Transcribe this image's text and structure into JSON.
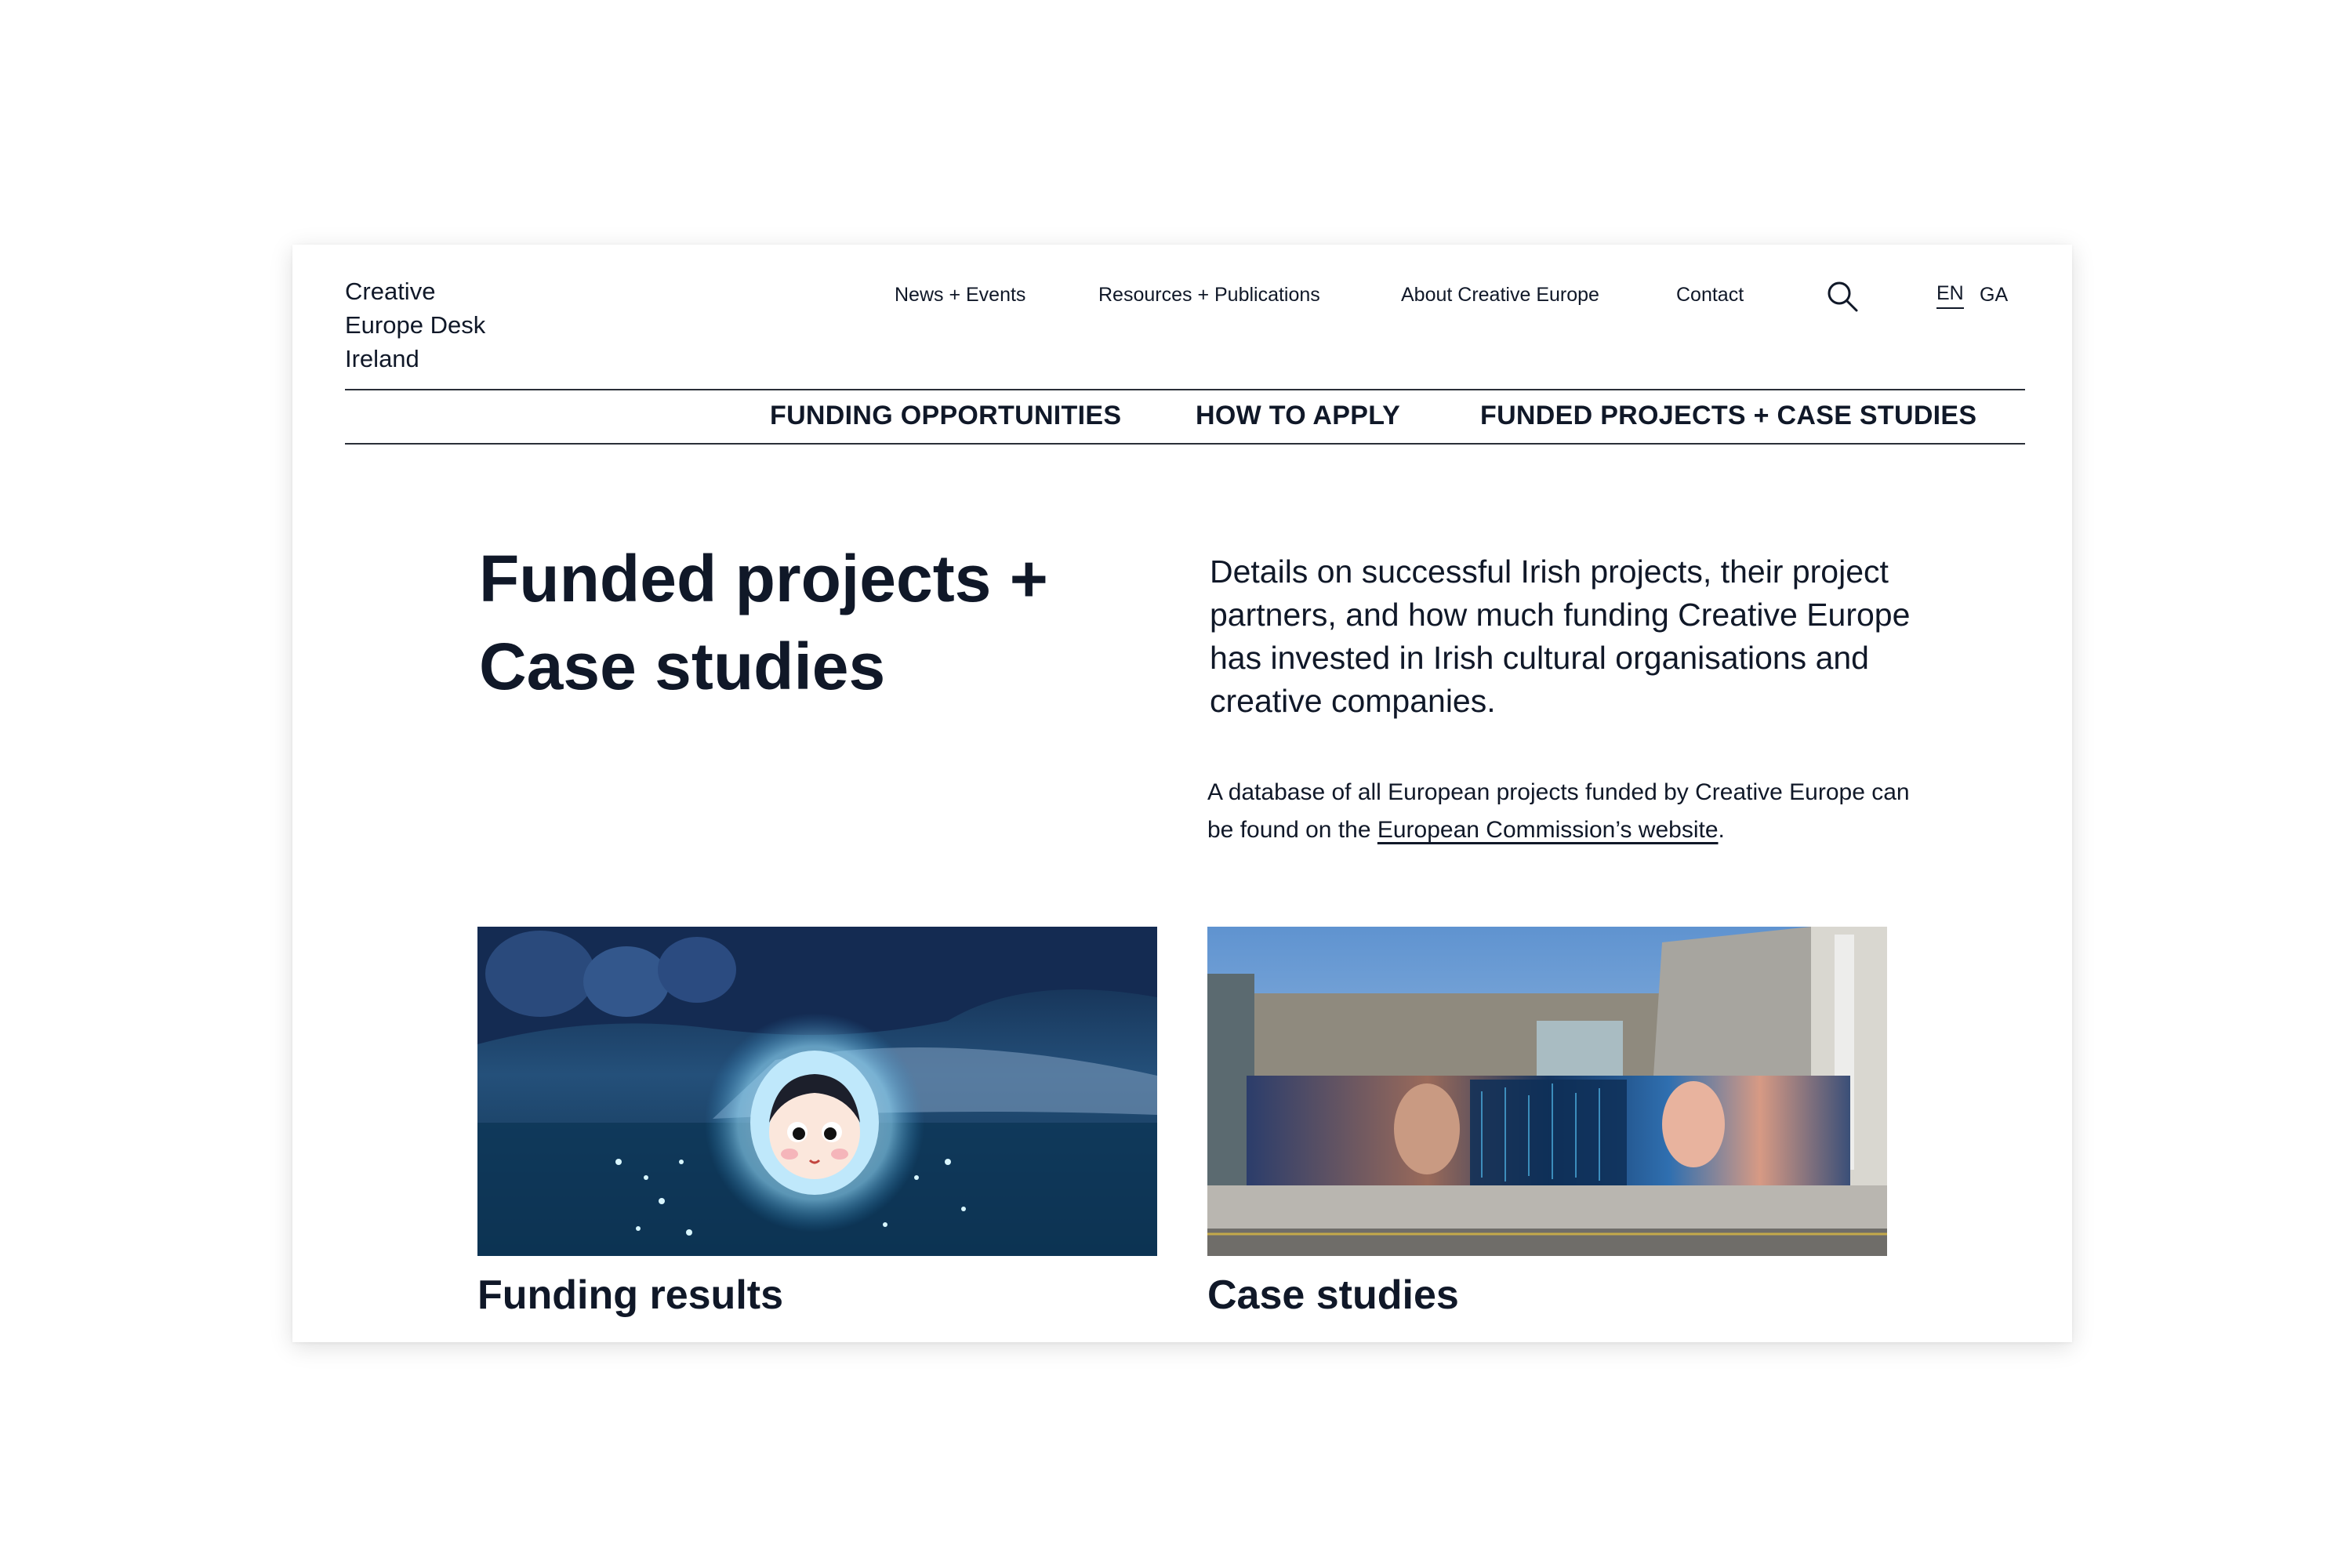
{
  "logo": {
    "text": "Creative\nEurope Desk\nIreland"
  },
  "top_nav": {
    "items": [
      "News + Events",
      "Resources + Publications",
      "About Creative Europe",
      "Contact"
    ],
    "search_icon": "search-icon",
    "languages": {
      "active": "EN",
      "other": "GA"
    }
  },
  "sub_nav": {
    "items": [
      "FUNDING OPPORTUNITIES",
      "HOW TO APPLY",
      "FUNDED PROJECTS + CASE STUDIES"
    ]
  },
  "main": {
    "title": "Funded projects + Case studies",
    "intro": "Details on successful Irish projects, their project partners, and how much funding Creative Europe has invested in Irish cultural organisations and creative companies.",
    "note_prefix": "A database of all European projects funded by Creative Europe can be found on the ",
    "note_link": "European Commission’s website",
    "note_suffix": "."
  },
  "cards": [
    {
      "title": "Funding results",
      "image": "animated-character-in-water"
    },
    {
      "title": "Case studies",
      "image": "street-mural-photo"
    }
  ],
  "colors": {
    "text": "#101828",
    "rule": "#2a2f38",
    "background": "#ffffff"
  }
}
